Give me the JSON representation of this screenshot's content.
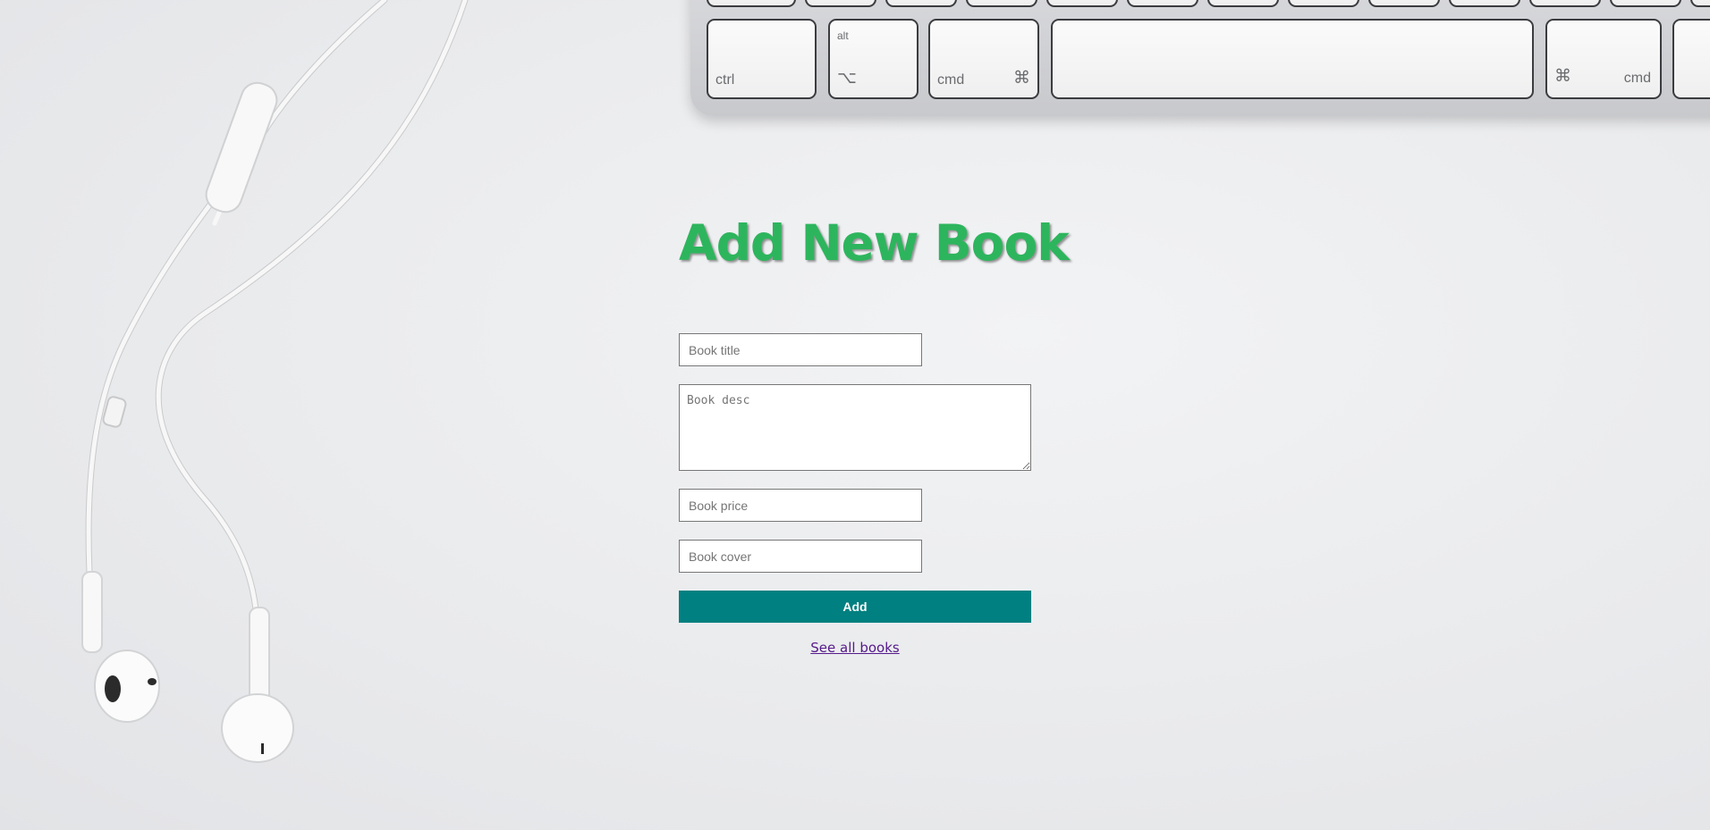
{
  "page": {
    "title": "Add New Book"
  },
  "form": {
    "title_placeholder": "Book title",
    "desc_placeholder": "Book desc",
    "price_placeholder": "Book price",
    "cover_placeholder": "Book cover",
    "submit_label": "Add",
    "link_label": "See all books"
  },
  "keyboard": {
    "ctrl_label": "ctrl",
    "alt_label": "alt",
    "option_symbol": "⌥",
    "cmd_label_left": "cmd",
    "cmd_symbol_left": "⌘",
    "cmd_symbol_right": "⌘",
    "cmd_label_right": "cmd"
  },
  "colors": {
    "title_green": "#2db55d",
    "button_teal": "#008080",
    "link_visited": "#551a8b"
  }
}
